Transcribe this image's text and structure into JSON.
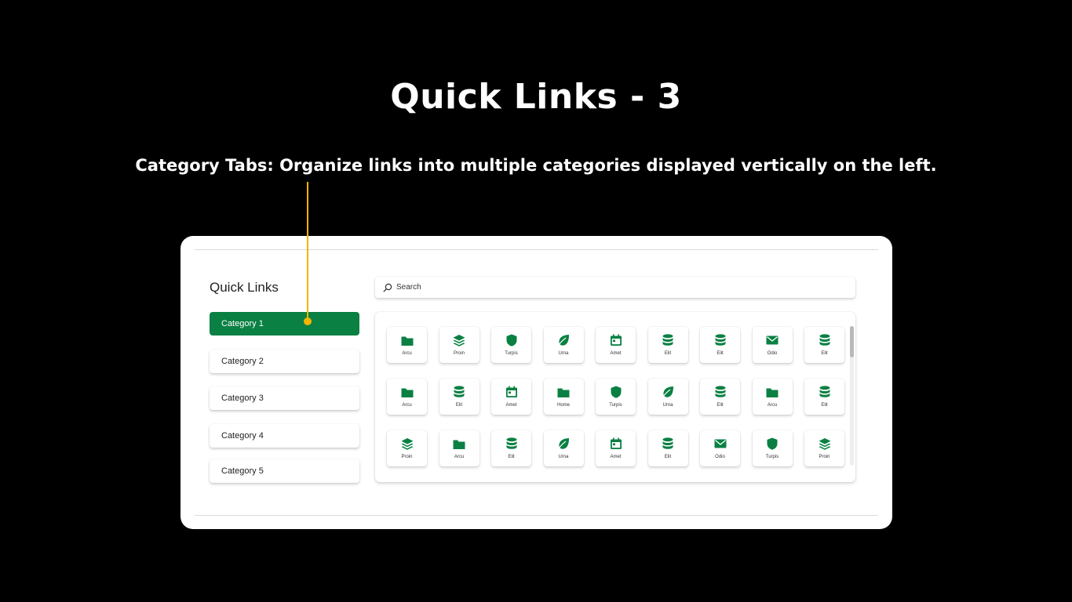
{
  "slide": {
    "title": "Quick Links - 3",
    "subtitle": "Category Tabs: Organize links into multiple categories displayed vertically on the left."
  },
  "colors": {
    "accent": "#0a8043",
    "callout": "#f5b400",
    "background": "#000000"
  },
  "widget": {
    "title": "Quick Links",
    "categories": [
      {
        "label": "Category 1",
        "active": true
      },
      {
        "label": "Category 2",
        "active": false
      },
      {
        "label": "Category 3",
        "active": false
      },
      {
        "label": "Category 4",
        "active": false
      },
      {
        "label": "Category 5",
        "active": false
      }
    ],
    "search": {
      "placeholder": "Search"
    },
    "links": [
      [
        {
          "label": "Arcu",
          "icon": "folder-icon"
        },
        {
          "label": "Proin",
          "icon": "layers-icon"
        },
        {
          "label": "Turpis",
          "icon": "shield-icon"
        },
        {
          "label": "Urna",
          "icon": "leaf-icon"
        },
        {
          "label": "Amet",
          "icon": "calendar-icon"
        },
        {
          "label": "Elit",
          "icon": "database-icon"
        },
        {
          "label": "Elit",
          "icon": "database-icon"
        },
        {
          "label": "Odio",
          "icon": "mail-icon"
        },
        {
          "label": "Elit",
          "icon": "database-icon"
        }
      ],
      [
        {
          "label": "Arcu",
          "icon": "folder-icon"
        },
        {
          "label": "Elit",
          "icon": "database-icon"
        },
        {
          "label": "Amet",
          "icon": "calendar-icon"
        },
        {
          "label": "Home",
          "icon": "folder-icon"
        },
        {
          "label": "Turpis",
          "icon": "shield-icon"
        },
        {
          "label": "Urna",
          "icon": "leaf-icon"
        },
        {
          "label": "Elit",
          "icon": "database-icon"
        },
        {
          "label": "Arcu",
          "icon": "folder-icon"
        },
        {
          "label": "Elit",
          "icon": "database-icon"
        }
      ],
      [
        {
          "label": "Proin",
          "icon": "layers-icon"
        },
        {
          "label": "Arcu",
          "icon": "folder-icon"
        },
        {
          "label": "Elit",
          "icon": "database-icon"
        },
        {
          "label": "Urna",
          "icon": "leaf-icon"
        },
        {
          "label": "Amet",
          "icon": "calendar-icon"
        },
        {
          "label": "Elit",
          "icon": "database-icon"
        },
        {
          "label": "Odio",
          "icon": "mail-icon"
        },
        {
          "label": "Turpis",
          "icon": "shield-icon"
        },
        {
          "label": "Proin",
          "icon": "layers-icon"
        }
      ]
    ]
  }
}
